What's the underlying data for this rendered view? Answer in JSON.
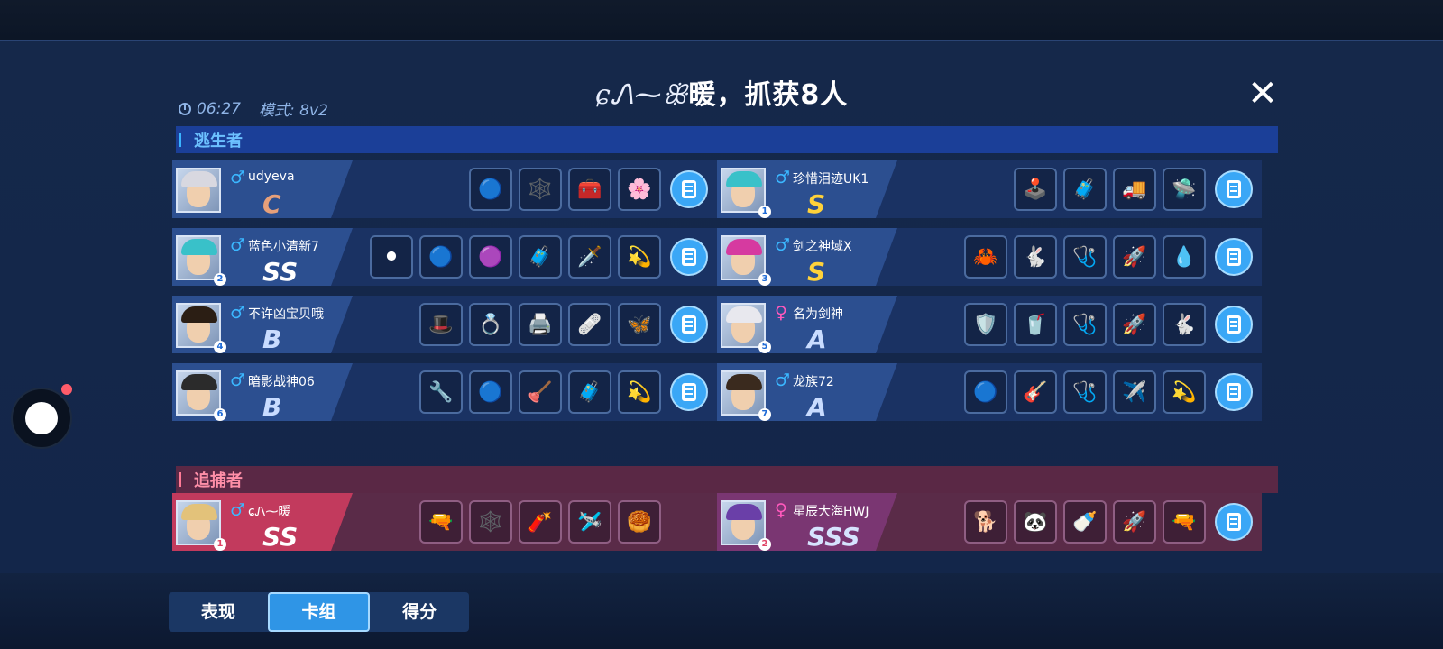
{
  "title": {
    "signature": "ɕᏁ⁓ꕥ",
    "text": "暖，抓获8人"
  },
  "meta": {
    "time": "06:27",
    "mode": "模式: 8v2"
  },
  "sections": {
    "escapees": "逃生者",
    "hunters": "追捕者"
  },
  "escapees_left": [
    {
      "number": "",
      "gender": "♂",
      "name": "udyeva",
      "rank": "C",
      "cards": [
        "🔵",
        "🕸️",
        "🧰",
        "🌸"
      ]
    },
    {
      "number": "2",
      "gender": "♂",
      "name": "蓝色小清新7",
      "rank": "SS",
      "cards": [
        "⚫",
        "🔵",
        "🟣",
        "🧳",
        "🗡️",
        "💫"
      ]
    },
    {
      "number": "4",
      "gender": "♂",
      "name": "不许凶宝贝哦",
      "rank": "B",
      "cards": [
        "🎩",
        "💍",
        "🖨️",
        "🩹",
        "🦋"
      ]
    },
    {
      "number": "6",
      "gender": "♂",
      "name": "暗影战神06",
      "rank": "B",
      "cards": [
        "🔧",
        "🔵",
        "🪠",
        "🧳",
        "💫"
      ]
    }
  ],
  "escapees_right": [
    {
      "number": "1",
      "gender": "♂",
      "name": "珍惜泪迹UK1",
      "rank": "S",
      "cards": [
        "🕹️",
        "🧳",
        "🚚",
        "🛸"
      ]
    },
    {
      "number": "3",
      "gender": "♂",
      "name": "剑之神域X",
      "rank": "S",
      "cards": [
        "🦀",
        "🐇",
        "🩺",
        "🚀",
        "💧"
      ]
    },
    {
      "number": "5",
      "gender": "♀",
      "name": "名为剑神",
      "rank": "A",
      "cards": [
        "🛡️",
        "🥤",
        "🩺",
        "🚀",
        "🐇"
      ]
    },
    {
      "number": "7",
      "gender": "♂",
      "name": "龙族72",
      "rank": "A",
      "cards": [
        "🔵",
        "🎸",
        "🩺",
        "✈️",
        "💫"
      ]
    }
  ],
  "hunters": [
    {
      "number": "1",
      "gender": "♂",
      "name": "ɕᏁ⁓暖",
      "rank": "SS",
      "cards": [
        "🔫",
        "🕸️",
        "🧨",
        "🛩️",
        "🥮"
      ],
      "deck_button": false
    },
    {
      "number": "2",
      "gender": "♀",
      "name": "星辰大海HWJ",
      "rank": "SSS",
      "cards": [
        "🐕",
        "🐼",
        "🍼",
        "🚀",
        "🔫"
      ],
      "deck_button": true
    }
  ],
  "tabs": [
    "表现",
    "卡组",
    "得分"
  ],
  "active_tab": "卡组",
  "colors": {
    "escape_bar": "#1b3f98",
    "hunter_bar": "#5a2845",
    "tab_active": "#2f95e6"
  }
}
